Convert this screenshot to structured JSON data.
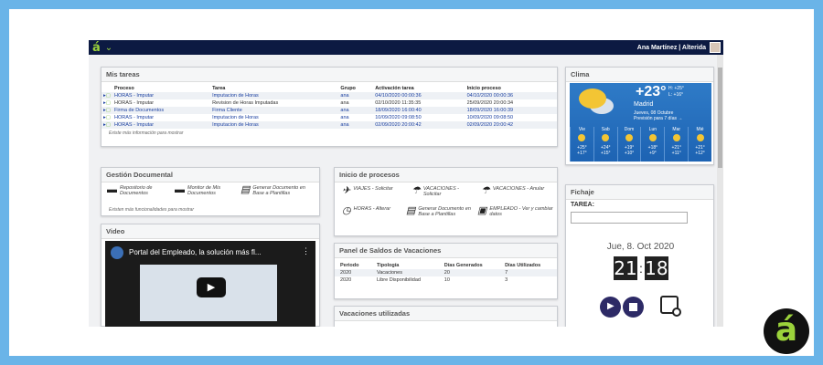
{
  "topbar": {
    "logo": "á",
    "chevron": "v",
    "user": "Ana Martínez | Alterida"
  },
  "tasks": {
    "title": "Mis tareas",
    "headers": [
      "Proceso",
      "Tarea",
      "Grupo",
      "Activación tarea",
      "Inicio proceso"
    ],
    "rows": [
      {
        "proceso": "HORAS - Imputar",
        "tarea": "Imputacion de Horas",
        "grupo": "ana",
        "activacion": "04/10/2020 00:00:36",
        "inicio": "04/10/2020 00:00:36"
      },
      {
        "proceso": "HORAS - Imputar",
        "tarea": "Revision de Horas Imputadas",
        "grupo": "ana",
        "activacion": "02/10/2020 11:35:35",
        "inicio": "25/09/2020 20:00:34"
      },
      {
        "proceso": "Firma de Documentos",
        "tarea": "Firma Cliente",
        "grupo": "ana",
        "activacion": "18/09/2020 16:00:40",
        "inicio": "18/09/2020 16:00:39"
      },
      {
        "proceso": "HORAS - Imputar",
        "tarea": "Imputacion de Horas",
        "grupo": "ana",
        "activacion": "10/09/2020 09:08:50",
        "inicio": "10/09/2020 09:08:50"
      },
      {
        "proceso": "HORAS - Imputar",
        "tarea": "Imputacion de Horas",
        "grupo": "ana",
        "activacion": "02/09/2020 20:00:42",
        "inicio": "02/09/2020 20:00:42"
      }
    ],
    "note": "Existe más información para mostrar"
  },
  "clima": {
    "title": "Clima",
    "temp": "+23°",
    "hilo": "H: +25°\nL: +16°",
    "city": "Madrid",
    "date": "Jueves, 08 Octubre",
    "forecast_note": "Previsión para 7 días →",
    "days": [
      {
        "d": "Vie",
        "h": "+25°",
        "l": "+17°"
      },
      {
        "d": "Sab",
        "h": "+24°",
        "l": "+15°"
      },
      {
        "d": "Dom",
        "h": "+19°",
        "l": "+10°"
      },
      {
        "d": "Lun",
        "h": "+18°",
        "l": "+9°"
      },
      {
        "d": "Mar",
        "h": "+21°",
        "l": "+11°"
      },
      {
        "d": "Mié",
        "h": "+21°",
        "l": "+12°"
      }
    ]
  },
  "gestion": {
    "title": "Gestión Documental",
    "items": [
      "Repositorio de Documentos",
      "Monitor de Mis Documentos",
      "Generar Documento en Base a Plantillas"
    ],
    "note": "Existen más funcionalidades para mostrar"
  },
  "inicio": {
    "title": "Inicio de procesos",
    "items": [
      "VIAJES - Solicitar",
      "VACACIONES - Solicitar",
      "VACACIONES - Anular",
      "HORAS - Alterar",
      "Generar Documento en Base a Plantillas",
      "EMPLEADO - Ver y cambiar datos"
    ]
  },
  "video": {
    "title": "Video",
    "caption": "Portal del Empleado, la solución más fl..."
  },
  "saldos": {
    "title": "Panel de Saldos de Vacaciones",
    "headers": [
      "Periodo",
      "Tipología",
      "Días Generados",
      "Días Utilizados"
    ],
    "rows": [
      [
        "2020",
        "Vacaciones",
        "20",
        "7"
      ],
      [
        "2020",
        "Libre Disponibilidad",
        "10",
        "3"
      ]
    ]
  },
  "utilizadas": {
    "title": "Vacaciones utilizadas"
  },
  "fichaje": {
    "title": "Fichaje",
    "tarea_label": "TAREA:",
    "date": "Jue, 8. Oct 2020",
    "hour": "21",
    "minute": "18"
  },
  "colors": {
    "accent": "#9bd23b",
    "navy": "#0c1a42",
    "link": "#1a3fa0",
    "frame": "#6ab4e8"
  }
}
